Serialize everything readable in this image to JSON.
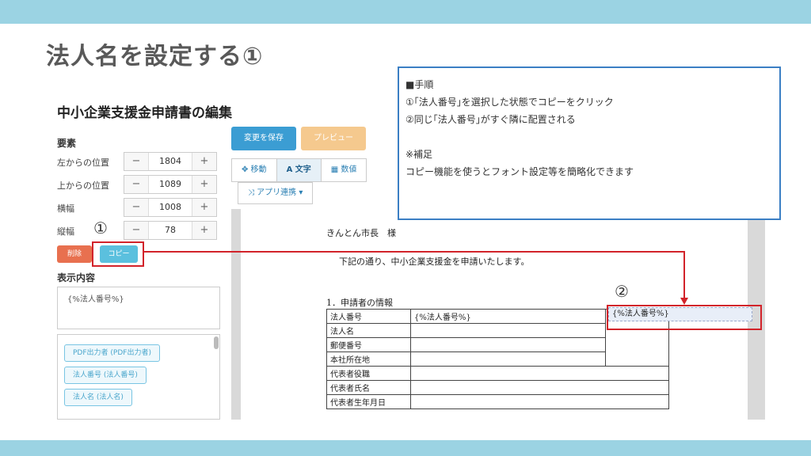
{
  "slide": {
    "title": "法人名を設定する①"
  },
  "steps_box": {
    "lines": [
      "■手順",
      "①｢法人番号｣を選択した状態でコピーをクリック",
      "②同じ｢法人番号｣がすぐ隣に配置される",
      "",
      "※補足",
      "コピー機能を使うとフォント設定等を簡略化できます"
    ]
  },
  "markers": {
    "one": "①",
    "two": "②"
  },
  "editor": {
    "title": "中小企業支援金申請書の編集",
    "element_label": "要素",
    "fields": [
      {
        "label": "左からの位置",
        "value": "1804"
      },
      {
        "label": "上からの位置",
        "value": "1089"
      },
      {
        "label": "横幅",
        "value": "1008"
      },
      {
        "label": "縦幅",
        "value": "78"
      }
    ],
    "minus": "−",
    "plus": "+",
    "delete_label": "削除",
    "copy_label": "コピー",
    "display_label": "表示内容",
    "display_value": "{%法人番号%}",
    "chips": [
      "PDF出力者 (PDF出力者)",
      "法人番号 (法人番号)",
      "法人名 (法人名)"
    ],
    "save_label": "変更を保存",
    "preview_label": "プレビュー",
    "tabs": [
      "✥ 移動",
      "A 文字",
      "▦ 数値"
    ],
    "app_label": "⤨ アプリ連携 ▾"
  },
  "document": {
    "addressee": "きんとん市長　様",
    "intro": "下記の通り、中小企業支援金を申請いたします。",
    "section": "1．申請者の情報",
    "rows": [
      "法人番号",
      "法人名",
      "郵便番号",
      "本社所在地",
      "代表者役職",
      "代表者氏名",
      "代表者生年月日"
    ],
    "field_value": "{%法人番号%}",
    "copied_value": "{%法人番号%}"
  },
  "colors": {
    "accent_bar": "#9bd3e3",
    "annotation_red": "#d2232a",
    "note_border": "#3b7fc4",
    "copy_button": "#5bc0de",
    "save_button": "#3b9dd3",
    "delete_button": "#e8704f"
  }
}
